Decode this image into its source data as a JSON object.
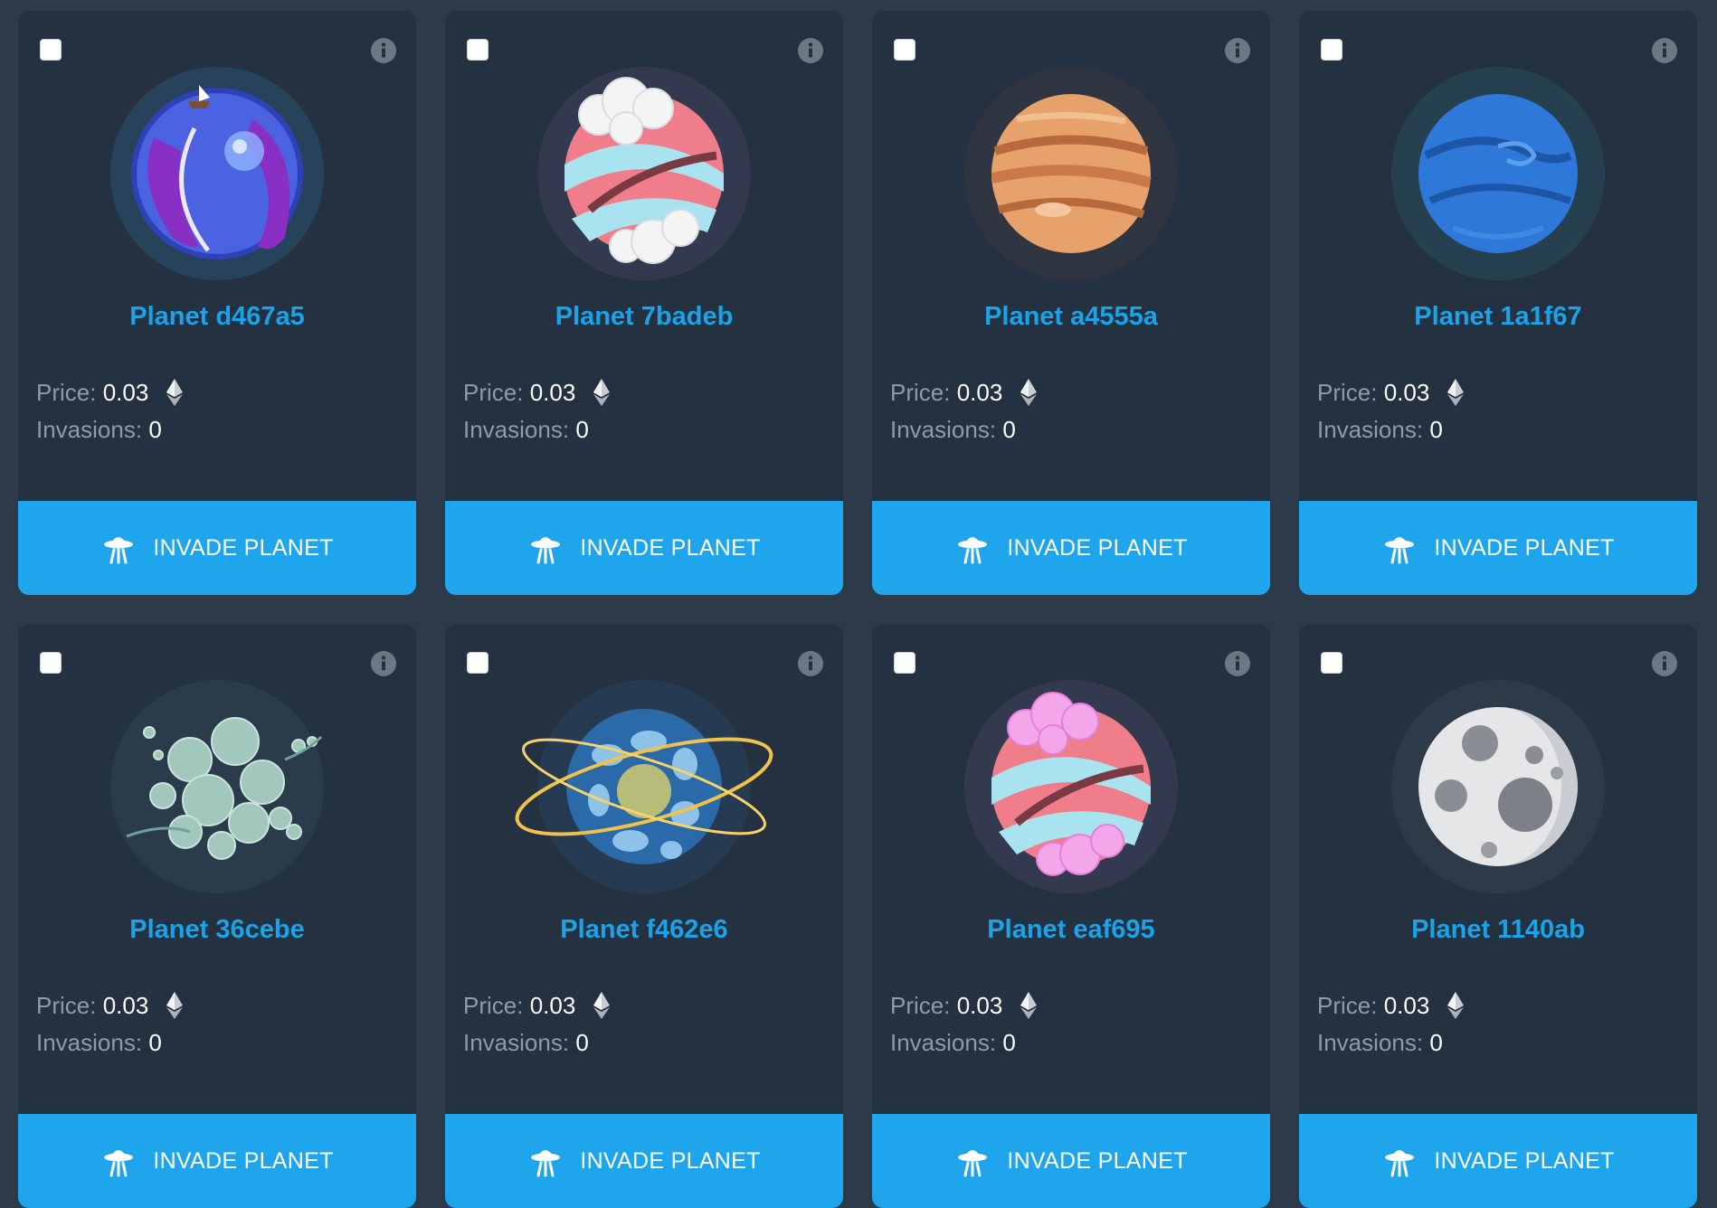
{
  "labels": {
    "price": "Price:",
    "invasions": "Invasions:",
    "invade_button": "INVADE PLANET"
  },
  "icons": {
    "info": "info-icon",
    "currency": "ethereum-icon",
    "button": "ufo-icon"
  },
  "colors": {
    "page_bg": "#2c3a4a",
    "card_bg": "#243140",
    "accent": "#1fa5ec",
    "name_text": "#1aa3e8"
  },
  "planets": [
    {
      "name": "Planet d467a5",
      "price": "0.03",
      "invasions": "0",
      "style": "tentacle-water"
    },
    {
      "name": "Planet 7badeb",
      "price": "0.03",
      "invasions": "0",
      "style": "pink-clouds"
    },
    {
      "name": "Planet a4555a",
      "price": "0.03",
      "invasions": "0",
      "style": "orange-gas"
    },
    {
      "name": "Planet 1a1f67",
      "price": "0.03",
      "invasions": "0",
      "style": "blue-swirl"
    },
    {
      "name": "Planet 36cebe",
      "price": "0.03",
      "invasions": "0",
      "style": "bubbles"
    },
    {
      "name": "Planet f462e6",
      "price": "0.03",
      "invasions": "0",
      "style": "electric-rings"
    },
    {
      "name": "Planet eaf695",
      "price": "0.03",
      "invasions": "0",
      "style": "pink-cotton"
    },
    {
      "name": "Planet 1140ab",
      "price": "0.03",
      "invasions": "0",
      "style": "moon"
    }
  ]
}
